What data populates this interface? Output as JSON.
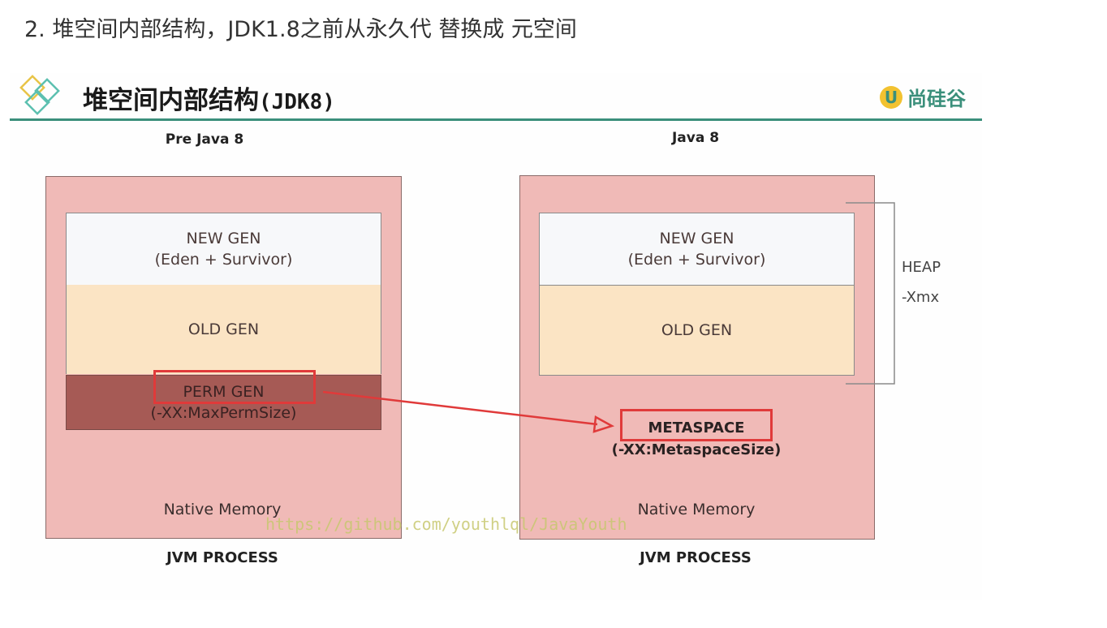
{
  "heading": "2. 堆空间内部结构，JDK1.8之前从永久代 替换成 元空间",
  "slide": {
    "title": "堆空间内部结构",
    "title_suffix": "(JDK8)",
    "brand": "尚硅谷",
    "brand_mark": "U"
  },
  "left": {
    "label": "Pre Java 8",
    "new_gen_line1": "NEW GEN",
    "new_gen_line2": "(Eden + Survivor)",
    "old_gen": "OLD GEN",
    "perm_gen_line1": "PERM GEN",
    "perm_gen_line2": "(-XX:MaxPermSize)",
    "native_memory": "Native Memory",
    "process_label": "JVM PROCESS"
  },
  "right": {
    "label": "Java 8",
    "new_gen_line1": "NEW GEN",
    "new_gen_line2": "(Eden + Survivor)",
    "old_gen": "OLD GEN",
    "metaspace": "METASPACE",
    "metaspace_option": "(-XX:MetaspaceSize)",
    "native_memory": "Native Memory",
    "process_label": "JVM PROCESS",
    "heap_label": "HEAP",
    "heap_option": "-Xmx"
  },
  "watermark": "https://github.com/youthlql/JavaYouth",
  "colors": {
    "accent": "#3a8f7b",
    "highlight": "#e03a3a",
    "process_bg": "#f0bab7",
    "old_gen_bg": "#fbe4c4",
    "perm_gen_bg": "#a65a55"
  }
}
